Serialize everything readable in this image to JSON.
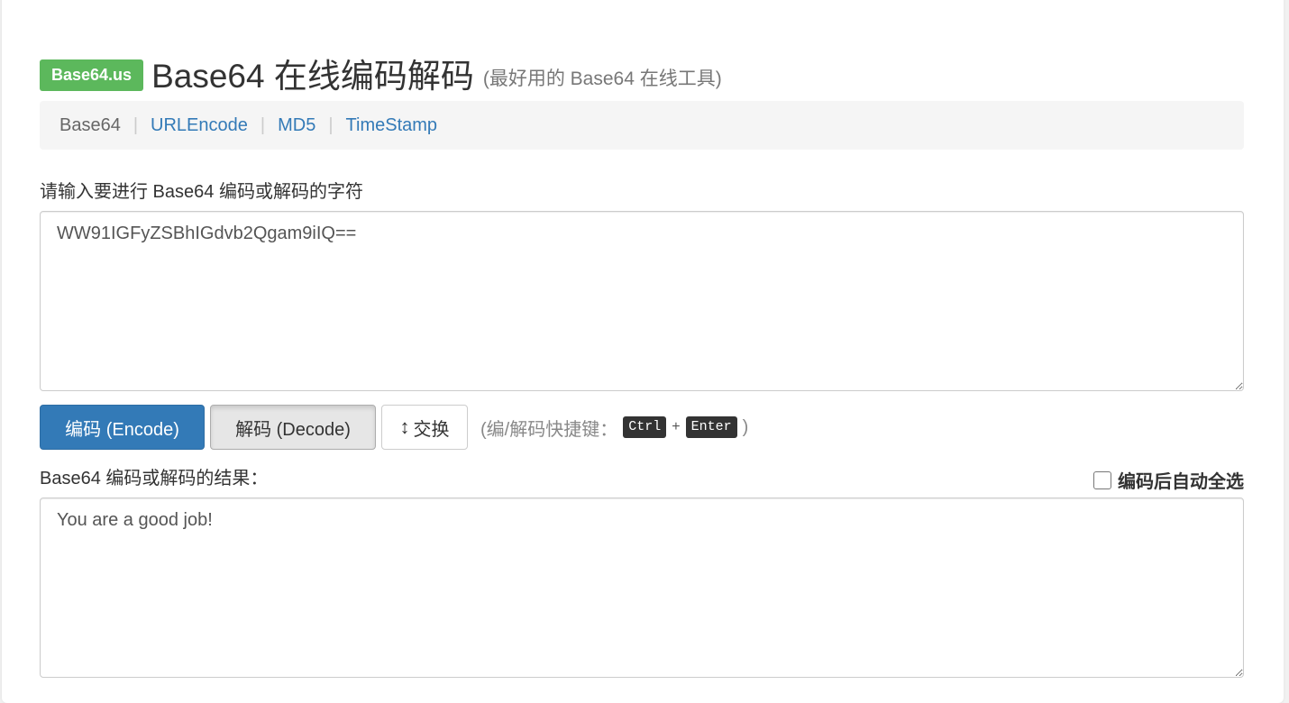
{
  "header": {
    "badge": "Base64.us",
    "title": "Base64 在线编码解码",
    "subtitle": "(最好用的 Base64 在线工具)"
  },
  "nav": {
    "items": [
      {
        "label": "Base64",
        "active": true
      },
      {
        "label": "URLEncode",
        "active": false
      },
      {
        "label": "MD5",
        "active": false
      },
      {
        "label": "TimeStamp",
        "active": false
      }
    ],
    "separator": "|"
  },
  "input": {
    "label": "请输入要进行 Base64 编码或解码的字符",
    "value": "WW91IGFyZSBhIGdvb2Qgam9iIQ=="
  },
  "buttons": {
    "encode": "编码 (Encode)",
    "decode": "解码 (Decode)",
    "swap": "交换",
    "swap_icon": "↕"
  },
  "shortcut": {
    "prefix": "(编/解码快捷键：",
    "key1": "Ctrl",
    "plus": "+",
    "key2": "Enter",
    "suffix": ")"
  },
  "output": {
    "label": "Base64 编码或解码的结果：",
    "value": "You are a good job!",
    "autoselect_label": "编码后自动全选",
    "autoselect_checked": false
  },
  "colors": {
    "brand": "#5cb85c",
    "primary": "#337ab7",
    "link": "#337ab7"
  }
}
